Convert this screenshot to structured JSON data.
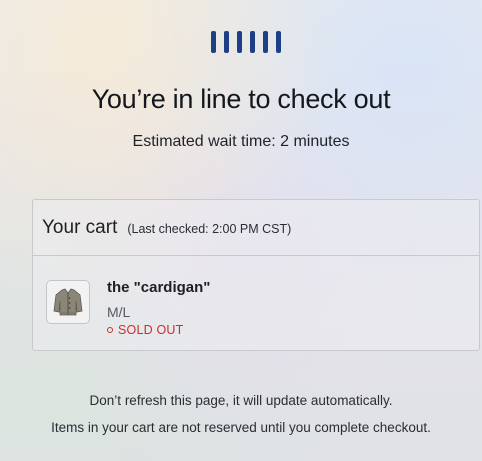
{
  "queue": {
    "indicator_icon": "queue-progress-bars-icon",
    "bar_count": 6,
    "accent_color": "#1d3f86"
  },
  "headline": "You’re in line to check out",
  "wait_text": "Estimated wait time: 2 minutes",
  "cart": {
    "title": "Your cart",
    "last_checked": "(Last checked: 2:00 PM CST)",
    "items": [
      {
        "name": "the \"cardigan\"",
        "variant": "M/L",
        "status": "SOLD OUT",
        "status_color": "#c8302a",
        "thumbnail_icon": "cardigan-thumbnail"
      }
    ]
  },
  "notes": {
    "refresh": "Don’t refresh this page, it will update automatically.",
    "reserved": "Items in your cart are not reserved until you complete checkout."
  }
}
